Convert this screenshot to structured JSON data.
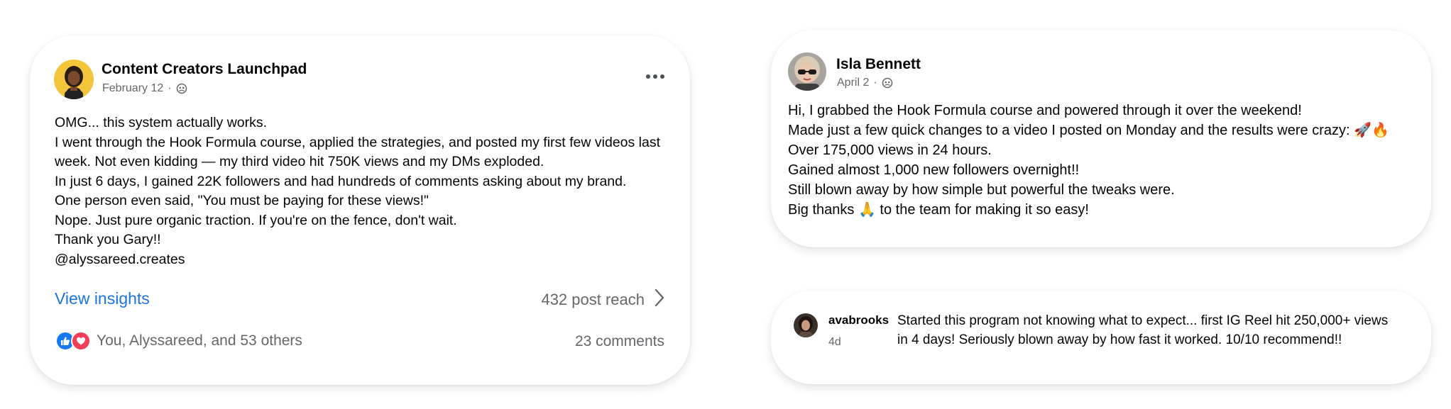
{
  "post1": {
    "author": "Content Creators Launchpad",
    "date": "February 12",
    "separator": "·",
    "audience_icon": "friends-globe-icon",
    "more_icon": "more-options-icon",
    "lines": [
      "OMG... this system actually works.",
      "I went through the Hook Formula course, applied the strategies, and posted my first few videos last",
      "week.  Not even kidding — my third video hit 750K views and my DMs exploded.",
      "In just 6 days, I gained 22K followers and had hundreds of comments asking about my brand.",
      "One person even said, \"You must be paying for these views!\"",
      "Nope. Just pure organic traction.  If you're on the fence, don't wait.",
      "Thank you Gary!!",
      "@alyssareed.creates"
    ],
    "view_insights": "View insights",
    "post_reach": "432 post reach",
    "reactions_text": "You, Alyssareed, and 53 others",
    "comments": "23 comments",
    "like_color": "#1877f2",
    "love_color": "#f33e58"
  },
  "post2": {
    "author": "Isla Bennett",
    "date": "April 2",
    "separator": "·",
    "audience_icon": "friends-globe-icon",
    "lines": [
      "Hi, I grabbed the Hook Formula course and powered through it over the weekend!",
      "Made just a few quick changes to a video I posted on Monday and the results were crazy: 🚀🔥",
      "Over 175,000 views in 24 hours.",
      "Gained almost 1,000 new followers overnight!!",
      "Still blown away by how simple but powerful the tweaks were.",
      "Big thanks 🙏 to the team for making it so easy!"
    ]
  },
  "comment": {
    "author": "avabrooks",
    "time": "4d",
    "lines": [
      "Started this program not knowing what to expect... first IG Reel hit 250,000+ views",
      "in 4 days! Seriously blown away by how fast it worked. 10/10 recommend!!"
    ]
  }
}
